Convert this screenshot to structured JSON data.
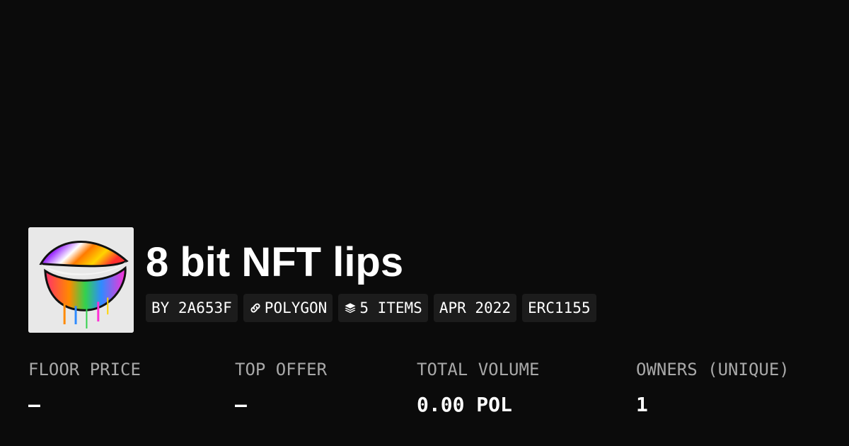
{
  "collection": {
    "title": "8 bit NFT lips",
    "image_icon": "lips-artwork-thumbnail"
  },
  "chips": [
    {
      "label": "BY 2A653F",
      "icon": ""
    },
    {
      "label": "POLYGON",
      "icon": "link-icon"
    },
    {
      "label": "5 ITEMS",
      "icon": "layers-icon"
    },
    {
      "label": "APR 2022",
      "icon": ""
    },
    {
      "label": "ERC1155",
      "icon": ""
    }
  ],
  "stats": [
    {
      "label": "FLOOR PRICE",
      "value": "–"
    },
    {
      "label": "TOP OFFER",
      "value": "–"
    },
    {
      "label": "TOTAL VOLUME",
      "value": "0.00 POL"
    },
    {
      "label": "OWNERS (UNIQUE)",
      "value": "1"
    }
  ],
  "colors": {
    "background": "#0b0b0b",
    "chip_background": "#1c1c1c",
    "label_gray": "#a8a8a8",
    "text": "#ffffff"
  }
}
